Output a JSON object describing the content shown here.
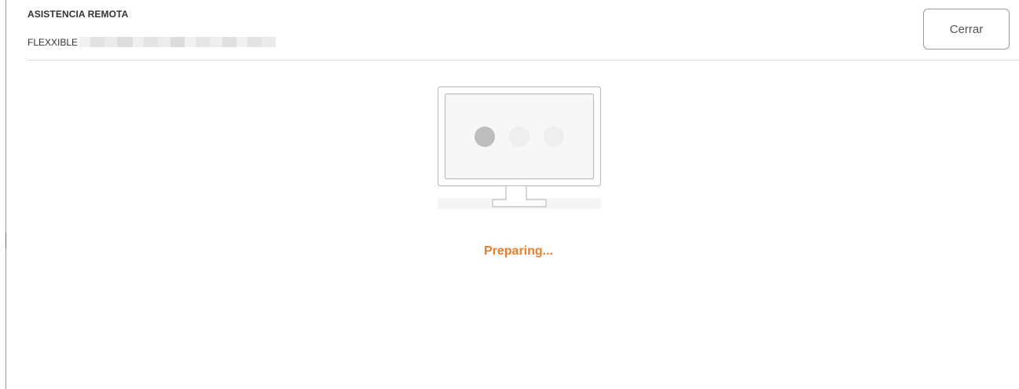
{
  "header": {
    "title": "ASISTENCIA REMOTA",
    "device_name": "FLEXXIBLE",
    "device_name_redacted": true,
    "close_label": "Cerrar"
  },
  "main": {
    "illustration": "monitor-loading-icon",
    "loading_dots": 3,
    "active_dot_index": 0,
    "status": "Preparing..."
  },
  "colors": {
    "accent": "#f07c28",
    "dot_active": "#bdbdbd",
    "dot_inactive": "#eeeeee",
    "monitor_stroke": "#bdbdbd",
    "divider": "#d9d9d9"
  }
}
